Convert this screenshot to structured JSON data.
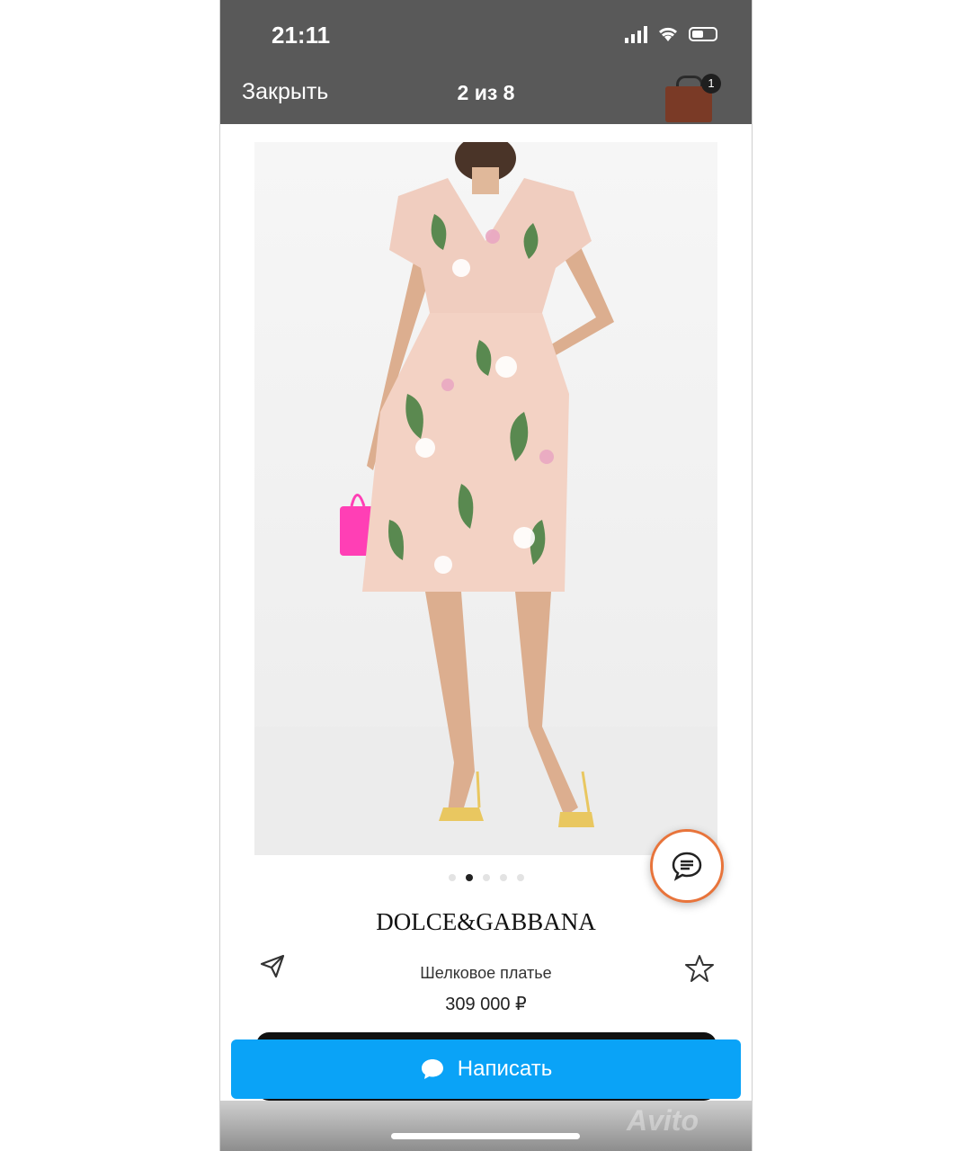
{
  "status_bar": {
    "time": "21:11"
  },
  "header": {
    "close_label": "Закрыть",
    "counter": "2 из 8",
    "cart_count": "1"
  },
  "gallery": {
    "dot_count": 5,
    "active_index": 1
  },
  "product": {
    "brand": "DOLCE&GABBANA",
    "name": "Шелковое платье",
    "price": "309 000 ₽"
  },
  "action": {
    "write_label": "Написать"
  },
  "watermark": "Avito",
  "colors": {
    "header_bg": "#595959",
    "primary_button": "#0aa3f7",
    "chat_ring": "#e8743b"
  }
}
